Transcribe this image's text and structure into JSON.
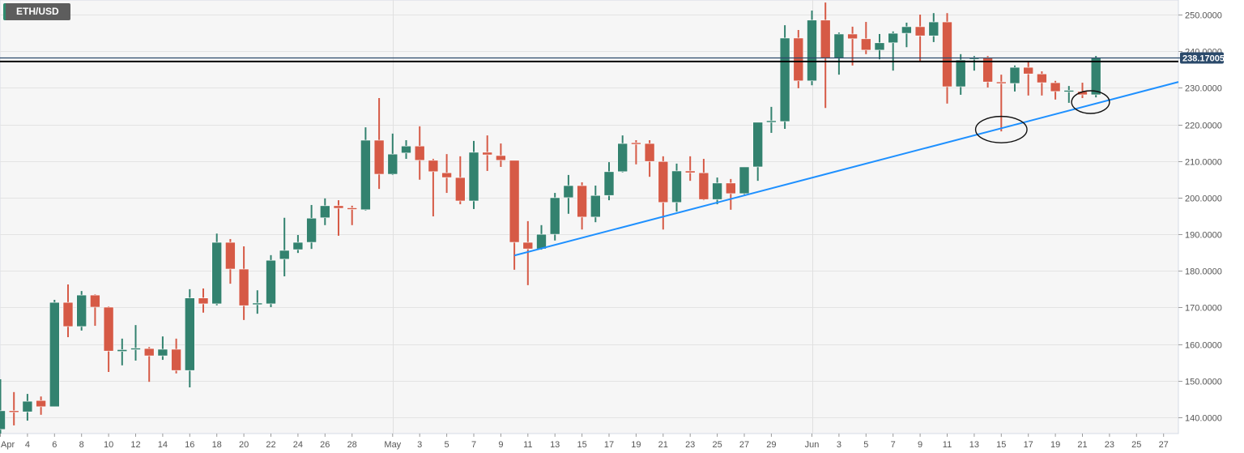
{
  "symbol": "ETH/USD",
  "colors": {
    "up": "#33826f",
    "down": "#d65a46",
    "trendline": "#1e90ff",
    "last_price_line": "#2b4a6b",
    "resistance": "#000000",
    "grid": "#e3e3e3",
    "background": "#f6f6f6"
  },
  "chart_data": {
    "type": "candlestick",
    "title": "ETH/USD",
    "xlabel": "",
    "ylabel": "",
    "ylim": [
      136,
      254
    ],
    "grid": true,
    "first_date": "Apr 2",
    "candle_fields": [
      "date",
      "open",
      "high",
      "low",
      "close"
    ],
    "candles": [
      [
        "Apr 2",
        136.7,
        150.4,
        135.5,
        141.8
      ],
      [
        "Apr 3",
        141.6,
        146.9,
        137.8,
        141.4
      ],
      [
        "Apr 4",
        141.5,
        146.4,
        139.1,
        144.4
      ],
      [
        "Apr 5",
        144.6,
        145.7,
        140.7,
        142.9
      ],
      [
        "Apr 6",
        142.9,
        172.1,
        142.9,
        171.4
      ],
      [
        "Apr 7",
        171.4,
        176.3,
        161.9,
        164.8
      ],
      [
        "Apr 8",
        164.8,
        174.5,
        163.7,
        173.4
      ],
      [
        "Apr 9",
        173.4,
        173.6,
        165.0,
        170.1
      ],
      [
        "Apr 10",
        170.1,
        170.3,
        152.4,
        158.1
      ],
      [
        "Apr 11",
        158.0,
        161.5,
        154.2,
        158.5
      ],
      [
        "Apr 12",
        158.5,
        165.2,
        155.5,
        158.7
      ],
      [
        "Apr 13",
        158.8,
        159.2,
        149.7,
        156.8
      ],
      [
        "Apr 14",
        156.8,
        162.1,
        155.7,
        158.6
      ],
      [
        "Apr 15",
        158.6,
        161.5,
        152.0,
        152.8
      ],
      [
        "Apr 16",
        152.8,
        175.0,
        148.2,
        172.6
      ],
      [
        "Apr 17",
        172.6,
        175.2,
        168.6,
        171.0
      ],
      [
        "Apr 18",
        171.0,
        190.2,
        170.6,
        187.8
      ],
      [
        "Apr 19",
        187.8,
        188.7,
        176.5,
        180.5
      ],
      [
        "Apr 20",
        180.5,
        186.7,
        166.6,
        170.5
      ],
      [
        "Apr 21",
        170.6,
        174.7,
        168.3,
        171.0
      ],
      [
        "Apr 22",
        171.0,
        184.3,
        170.1,
        182.9
      ],
      [
        "Apr 23",
        183.2,
        194.5,
        178.5,
        185.6
      ],
      [
        "Apr 24",
        185.8,
        189.8,
        184.9,
        187.8
      ],
      [
        "Apr 25",
        187.8,
        198.0,
        186.0,
        194.4
      ],
      [
        "Apr 26",
        194.5,
        199.8,
        192.5,
        197.8
      ],
      [
        "Apr 27",
        197.8,
        199.3,
        189.6,
        197.1
      ],
      [
        "Apr 28",
        197.0,
        197.8,
        192.5,
        196.6
      ],
      [
        "Apr 29",
        196.7,
        219.2,
        196.5,
        215.7
      ],
      [
        "Apr 30",
        215.7,
        227.2,
        202.4,
        206.4
      ],
      [
        "May 1",
        206.4,
        217.5,
        206.2,
        211.9
      ],
      [
        "May 2",
        212.2,
        215.7,
        210.6,
        214.1
      ],
      [
        "May 3",
        214.1,
        219.5,
        204.9,
        210.2
      ],
      [
        "May 4",
        210.2,
        210.6,
        194.9,
        207.1
      ],
      [
        "May 5",
        206.8,
        211.9,
        201.3,
        205.5
      ],
      [
        "May 6",
        205.5,
        211.3,
        198.2,
        199.1
      ],
      [
        "May 7",
        199.1,
        215.5,
        196.9,
        212.4
      ],
      [
        "May 8",
        212.4,
        217.0,
        207.3,
        211.7
      ],
      [
        "May 9",
        211.5,
        214.8,
        208.4,
        210.2
      ],
      [
        "May 10",
        210.2,
        210.2,
        180.3,
        187.8
      ],
      [
        "May 11",
        187.8,
        193.6,
        176.1,
        186.0
      ],
      [
        "May 12",
        186.0,
        192.5,
        185.8,
        190.0
      ],
      [
        "May 13",
        190.0,
        201.3,
        188.3,
        200.0
      ],
      [
        "May 14",
        200.0,
        206.2,
        195.6,
        203.3
      ],
      [
        "May 15",
        203.3,
        204.2,
        191.3,
        194.7
      ],
      [
        "May 16",
        194.7,
        203.3,
        193.3,
        200.6
      ],
      [
        "May 17",
        200.6,
        209.7,
        199.3,
        207.1
      ],
      [
        "May 18",
        207.1,
        217.0,
        206.9,
        214.8
      ],
      [
        "May 19",
        214.8,
        215.7,
        209.1,
        214.6
      ],
      [
        "May 20",
        214.8,
        215.7,
        205.7,
        209.9
      ],
      [
        "May 21",
        209.9,
        211.3,
        191.3,
        198.7
      ],
      [
        "May 22",
        198.7,
        209.3,
        196.2,
        207.3
      ],
      [
        "May 23",
        207.3,
        211.3,
        204.6,
        206.8
      ],
      [
        "May 24",
        206.8,
        210.6,
        199.3,
        199.5
      ],
      [
        "May 25",
        199.5,
        205.5,
        198.2,
        204.0
      ],
      [
        "May 26",
        204.0,
        205.1,
        196.7,
        201.1
      ],
      [
        "May 27",
        201.1,
        208.4,
        200.9,
        208.4
      ],
      [
        "May 28",
        208.4,
        220.6,
        204.6,
        220.6
      ],
      [
        "May 29",
        220.6,
        224.8,
        217.7,
        220.8
      ],
      [
        "May 30",
        220.8,
        247.1,
        218.8,
        243.6
      ],
      [
        "May 31",
        243.6,
        245.8,
        229.9,
        231.9
      ],
      [
        "Jun 1",
        231.9,
        251.1,
        230.7,
        248.5
      ],
      [
        "Jun 2",
        248.5,
        253.3,
        224.5,
        238.1
      ],
      [
        "Jun 3",
        238.1,
        245.1,
        233.6,
        244.7
      ],
      [
        "Jun 4",
        244.7,
        246.7,
        236.1,
        243.4
      ],
      [
        "Jun 5",
        243.4,
        248.0,
        239.2,
        240.3
      ],
      [
        "Jun 6",
        240.3,
        244.7,
        237.8,
        242.3
      ],
      [
        "Jun 7",
        242.3,
        245.4,
        234.7,
        244.9
      ],
      [
        "Jun 8",
        244.9,
        247.8,
        241.1,
        246.7
      ],
      [
        "Jun 9",
        246.7,
        250.0,
        237.4,
        244.2
      ],
      [
        "Jun 10",
        244.2,
        250.4,
        242.5,
        248.0
      ],
      [
        "Jun 11",
        248.0,
        250.4,
        225.7,
        230.3
      ],
      [
        "Jun 12",
        230.3,
        239.2,
        228.1,
        237.6
      ],
      [
        "Jun 13",
        237.8,
        238.7,
        234.7,
        238.3
      ],
      [
        "Jun 14",
        238.3,
        238.7,
        230.1,
        231.6
      ],
      [
        "Jun 15",
        231.4,
        233.6,
        218.1,
        231.2
      ],
      [
        "Jun 16",
        231.2,
        236.1,
        229.0,
        235.6
      ],
      [
        "Jun 17",
        235.6,
        237.2,
        227.9,
        233.8
      ],
      [
        "Jun 18",
        233.8,
        234.5,
        227.9,
        231.4
      ],
      [
        "Jun 19",
        231.4,
        231.9,
        226.8,
        229.0
      ],
      [
        "Jun 20",
        228.9,
        230.5,
        225.9,
        229.1
      ],
      [
        "Jun 21",
        229.0,
        231.4,
        227.2,
        228.1
      ],
      [
        "Jun 22",
        228.1,
        238.7,
        227.4,
        238.17
      ]
    ],
    "price_ticks": [
      "140.0000",
      "150.0000",
      "160.0000",
      "170.0000",
      "180.0000",
      "190.0000",
      "200.0000",
      "210.0000",
      "220.0000",
      "230.0000",
      "240.0000",
      "250.0000"
    ],
    "date_ticks": [
      {
        "label": "Apr",
        "i": 0
      },
      {
        "label": "4",
        "i": 2
      },
      {
        "label": "6",
        "i": 4
      },
      {
        "label": "8",
        "i": 6
      },
      {
        "label": "10",
        "i": 8
      },
      {
        "label": "12",
        "i": 10
      },
      {
        "label": "14",
        "i": 12
      },
      {
        "label": "16",
        "i": 14
      },
      {
        "label": "18",
        "i": 16
      },
      {
        "label": "20",
        "i": 18
      },
      {
        "label": "22",
        "i": 20
      },
      {
        "label": "24",
        "i": 22
      },
      {
        "label": "26",
        "i": 24
      },
      {
        "label": "28",
        "i": 26
      },
      {
        "label": "May",
        "i": 29
      },
      {
        "label": "3",
        "i": 31
      },
      {
        "label": "5",
        "i": 33
      },
      {
        "label": "7",
        "i": 35
      },
      {
        "label": "9",
        "i": 37
      },
      {
        "label": "11",
        "i": 39
      },
      {
        "label": "13",
        "i": 41
      },
      {
        "label": "15",
        "i": 43
      },
      {
        "label": "17",
        "i": 45
      },
      {
        "label": "19",
        "i": 47
      },
      {
        "label": "21",
        "i": 49
      },
      {
        "label": "23",
        "i": 51
      },
      {
        "label": "25",
        "i": 53
      },
      {
        "label": "27",
        "i": 55
      },
      {
        "label": "29",
        "i": 57
      },
      {
        "label": "Jun",
        "i": 60
      },
      {
        "label": "3",
        "i": 62
      },
      {
        "label": "5",
        "i": 64
      },
      {
        "label": "7",
        "i": 66
      },
      {
        "label": "9",
        "i": 68
      },
      {
        "label": "11",
        "i": 70
      },
      {
        "label": "13",
        "i": 72
      },
      {
        "label": "15",
        "i": 74
      },
      {
        "label": "17",
        "i": 76
      },
      {
        "label": "19",
        "i": 78
      },
      {
        "label": "21",
        "i": 80
      },
      {
        "label": "23",
        "i": 82
      },
      {
        "label": "25",
        "i": 84
      },
      {
        "label": "27",
        "i": 86
      }
    ],
    "month_separators": [
      29,
      60
    ],
    "last_price": "238.17005",
    "last_price_value": 238.17005,
    "resistance_level": 237.2,
    "trendline": {
      "from": {
        "i": 38,
        "price": 184.2
      },
      "to": {
        "i": 87.1,
        "price": 231.6
      }
    },
    "annotations": [
      {
        "type": "ellipse",
        "center_i": 74,
        "center_price": 218.6,
        "half_days": 1.9,
        "half_price": 3.6
      },
      {
        "type": "ellipse",
        "center_i": 80.6,
        "center_price": 226.1,
        "half_days": 1.4,
        "half_price": 3.1
      }
    ]
  }
}
